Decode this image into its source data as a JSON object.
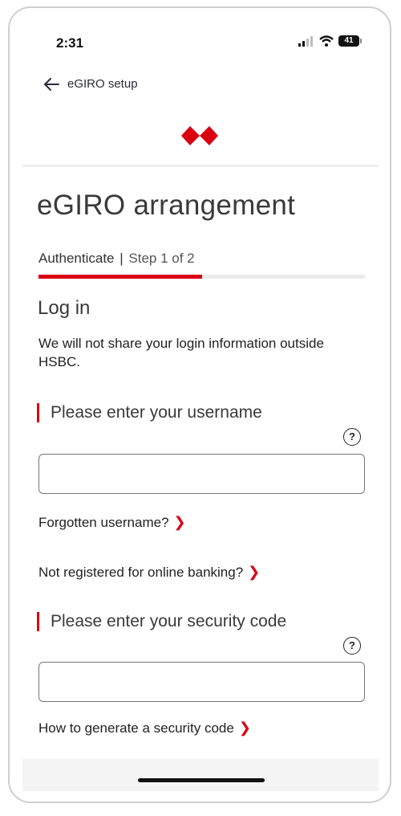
{
  "status_bar": {
    "time": "2:31",
    "battery_level": "41"
  },
  "nav": {
    "back_label": "eGIRO setup"
  },
  "page": {
    "title": "eGIRO arrangement"
  },
  "stepper": {
    "current": "Authenticate",
    "separator": "|",
    "step_text": "Step 1 of 2",
    "progress_fraction": 0.5
  },
  "login": {
    "heading": "Log in",
    "info": "We will not share your login information outside HSBC.",
    "username_label": "Please enter your username",
    "username_value": "",
    "forgot_username": "Forgotten username?",
    "not_registered": "Not registered for online banking?",
    "security_label": "Please enter your security code",
    "security_value": "",
    "how_to_generate": "How to generate a security code"
  },
  "icons": {
    "help": "question-circle-icon",
    "back": "arrow-left-icon",
    "chevron": "chevron-right-icon",
    "logo": "hsbc-hexagon-logo"
  },
  "colors": {
    "accent": "#db0011",
    "track": "#ececec",
    "text": "#1f1f1f"
  }
}
